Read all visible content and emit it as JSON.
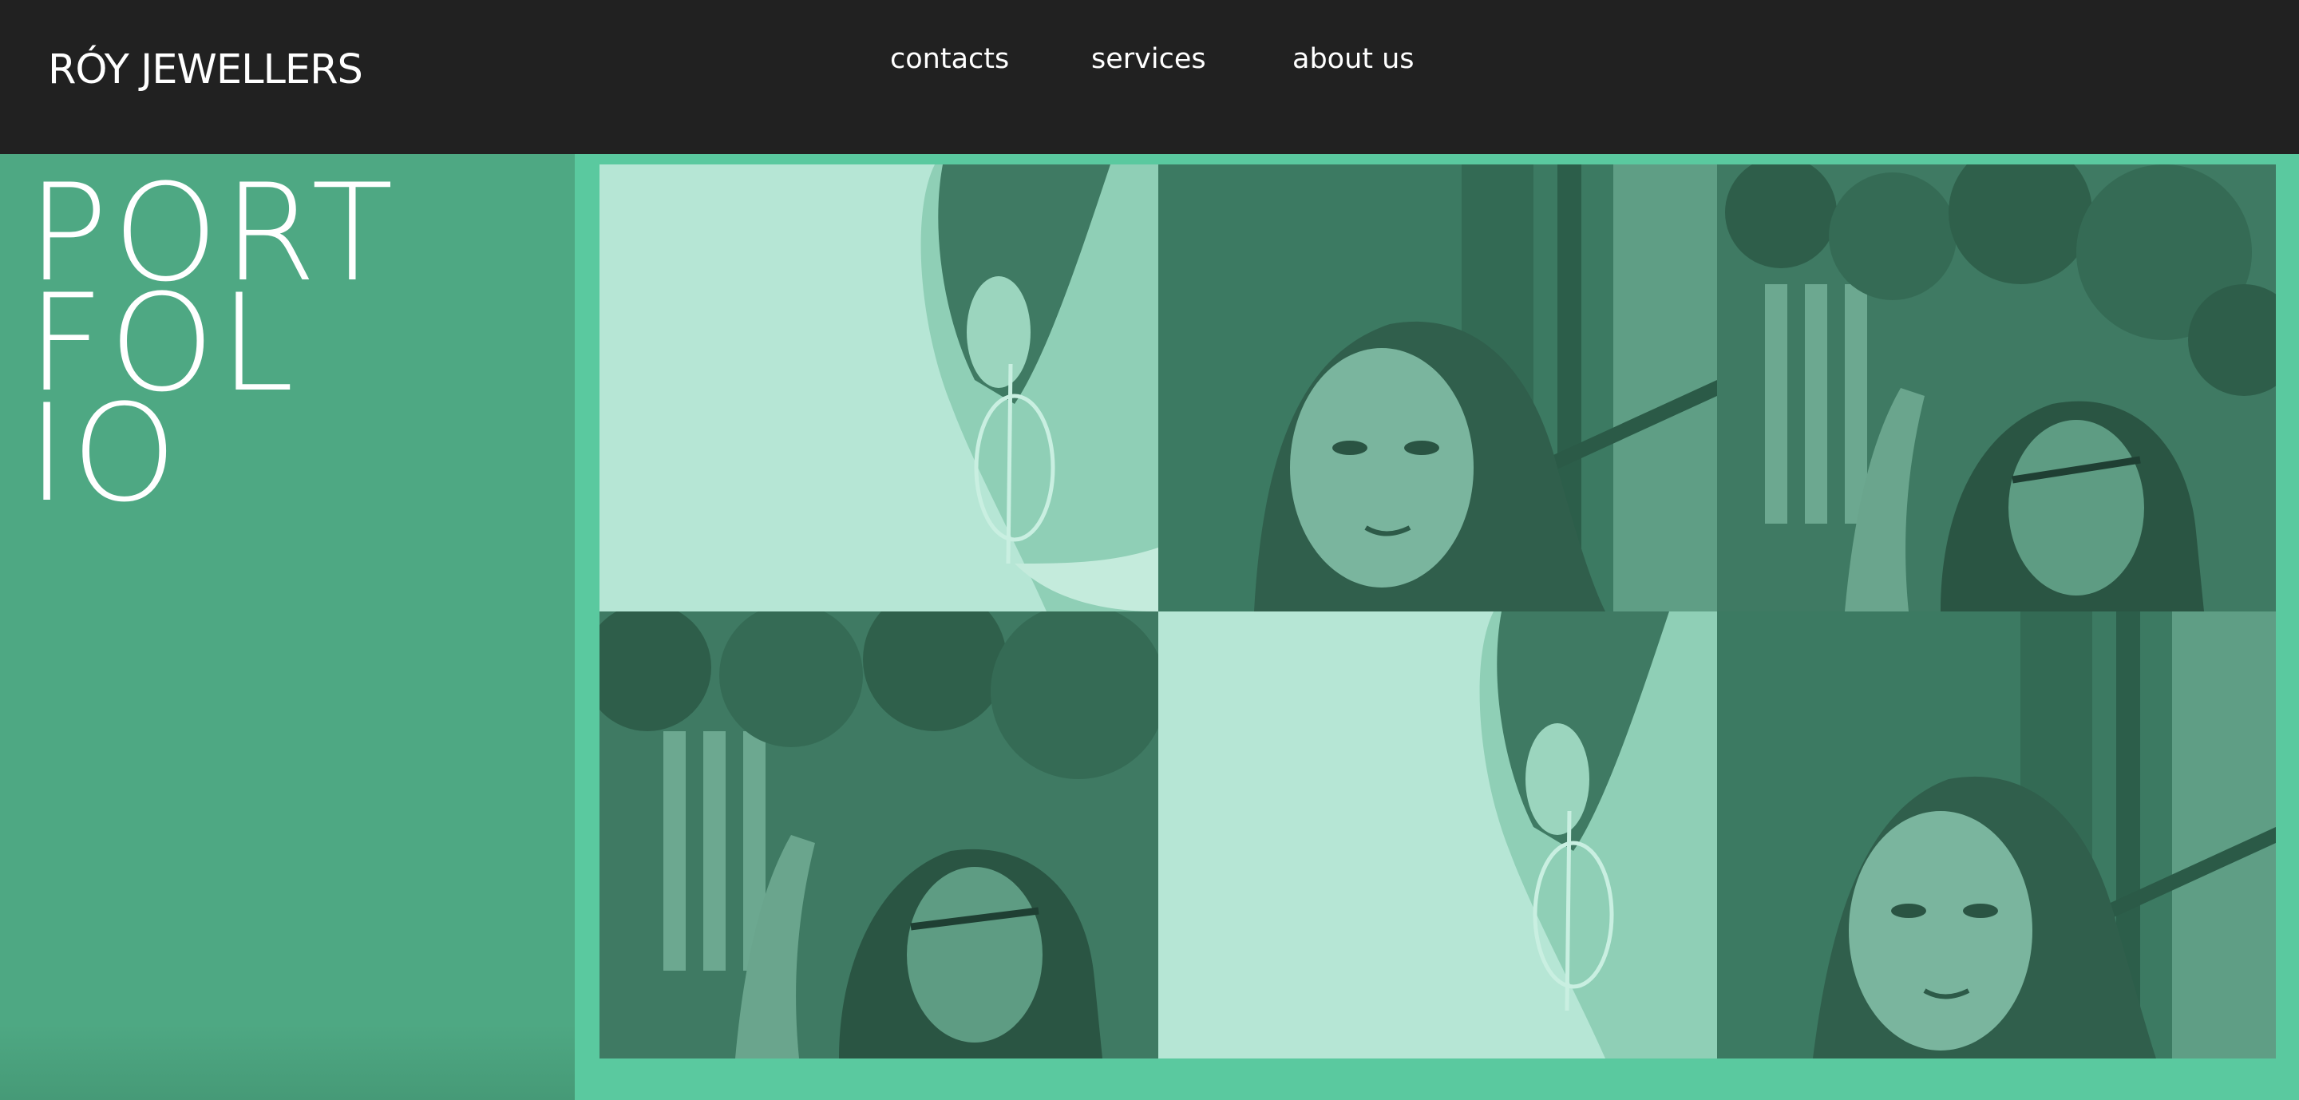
{
  "header": {
    "brand": "RÓY JEWELLERS",
    "nav": [
      "contacts",
      "services",
      "about us"
    ]
  },
  "sidebar": {
    "title_lines": [
      "PORT",
      "FOL",
      "IO"
    ]
  },
  "gallery": {
    "tiles": [
      {
        "subject": "earring-closeup"
      },
      {
        "subject": "woman-portrait"
      },
      {
        "subject": "woman-glasses-leaves"
      },
      {
        "subject": "woman-glasses-leaves"
      },
      {
        "subject": "earring-closeup"
      },
      {
        "subject": "woman-portrait"
      }
    ]
  },
  "colors": {
    "header_bg": "#212121",
    "sidebar_bg": "#4ea883",
    "accent_green": "#5ac99f",
    "photo_dark": "#3c7a62",
    "photo_light": "#b6e6d5"
  }
}
